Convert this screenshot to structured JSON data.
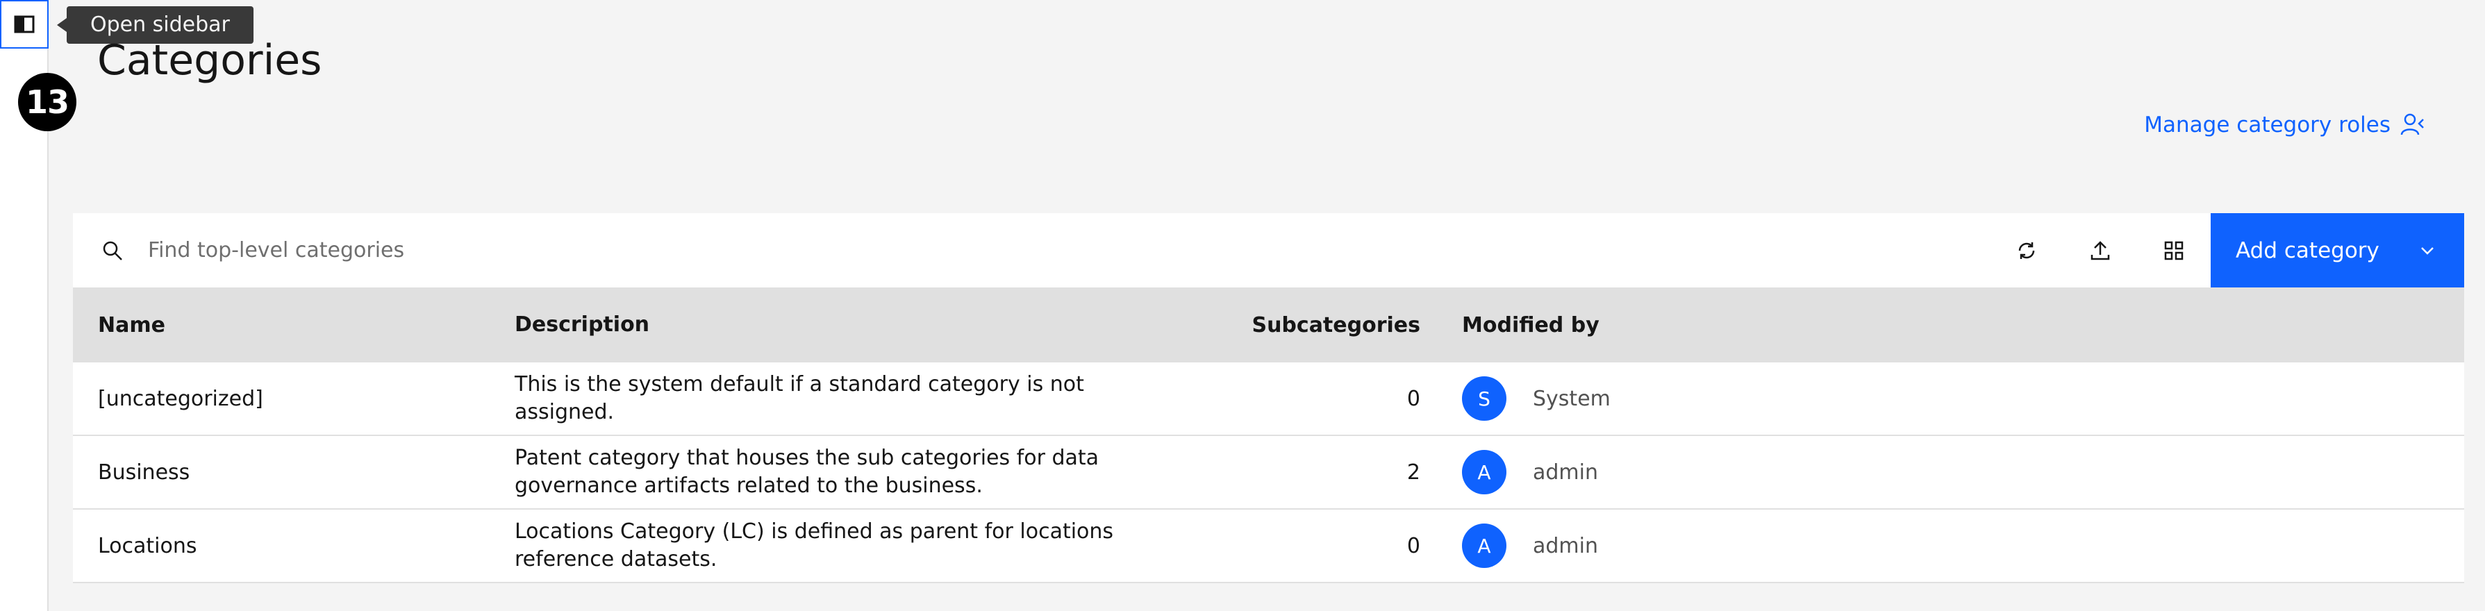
{
  "sidebar": {
    "toggle_tooltip": "Open sidebar",
    "step_badge": "13"
  },
  "header": {
    "title": "Categories",
    "roles_link": "Manage category roles"
  },
  "toolbar": {
    "search_placeholder": "Find top-level categories",
    "add_label": "Add category",
    "icons": [
      "refresh-icon",
      "upload-icon",
      "grid-view-icon",
      "chevron-down-icon"
    ]
  },
  "table": {
    "columns": [
      "Name",
      "Description",
      "Subcategories",
      "Modified by"
    ],
    "rows": [
      {
        "name": "[uncategorized]",
        "description": "This is the system default if a standard category is not assigned.",
        "subcategories": "0",
        "avatar": "S",
        "modified_by": "System"
      },
      {
        "name": "Business",
        "description": "Patent category that houses the sub categories for data governance artifacts related to the business.",
        "subcategories": "2",
        "avatar": "A",
        "modified_by": "admin"
      },
      {
        "name": "Locations",
        "description": "Locations Category (LC) is defined as parent for locations reference datasets.",
        "subcategories": "0",
        "avatar": "A",
        "modified_by": "admin"
      }
    ]
  },
  "colors": {
    "accent": "#0f62fe",
    "background": "#f4f4f4",
    "header_row": "#e0e0e0"
  }
}
